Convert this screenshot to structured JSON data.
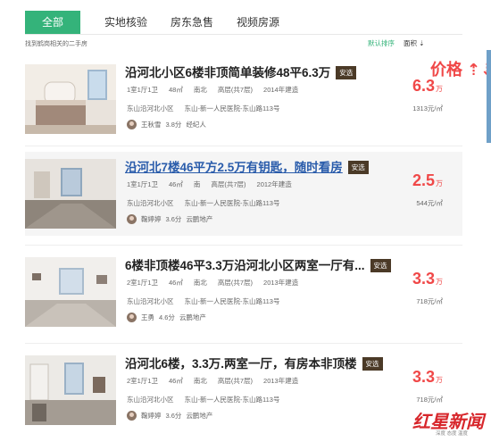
{
  "tabs": [
    {
      "label": "全部",
      "active": true
    },
    {
      "label": "实地核验",
      "active": false
    },
    {
      "label": "房东急售",
      "active": false
    },
    {
      "label": "视频房源",
      "active": false
    }
  ],
  "subbar": {
    "count_text": "找到鹤岗相关的二手房",
    "sort_default": "默认排序",
    "sort_area": "面积 ⇣",
    "sort_price": "价格 ⇡⇣"
  },
  "listings": [
    {
      "title": "沿河北小区6楼非顶简单装修48平6.3万",
      "badge": "安选",
      "layout": "1室1厅1卫",
      "area": "48㎡",
      "orientation": "南北",
      "floor": "高层(共7层)",
      "year": "2014年建造",
      "community": "东山沿河北小区",
      "address": "东山-新一人民医院-东山路113号",
      "agent_name": "王秋雪",
      "agent_score": "3.8分",
      "agent_company": "经纪人",
      "price": "6.3",
      "price_unit": "万",
      "unit_price": "1313元/㎡"
    },
    {
      "title": "沿河北7楼46平方2.5万有钥匙，随时看房",
      "badge": "安选",
      "layout": "1室1厅1卫",
      "area": "46㎡",
      "orientation": "南",
      "floor": "高层(共7层)",
      "year": "2012年建造",
      "community": "东山沿河北小区",
      "address": "东山-新一人民医院-东山路113号",
      "agent_name": "鞠婷婷",
      "agent_score": "3.6分",
      "agent_company": "云鹏地产",
      "price": "2.5",
      "price_unit": "万",
      "unit_price": "544元/㎡"
    },
    {
      "title": "6楼非顶楼46平3.3万沿河北小区两室一厅有...",
      "badge": "安选",
      "layout": "2室1厅1卫",
      "area": "46㎡",
      "orientation": "南北",
      "floor": "高层(共7层)",
      "year": "2013年建造",
      "community": "东山沿河北小区",
      "address": "东山-新一人民医院-东山路113号",
      "agent_name": "王勇",
      "agent_score": "4.6分",
      "agent_company": "云鹏地产",
      "price": "3.3",
      "price_unit": "万",
      "unit_price": "718元/㎡"
    },
    {
      "title": "沿河北6楼，3.3万.两室一厅，有房本非顶楼",
      "badge": "安选",
      "layout": "2室1厅1卫",
      "area": "46㎡",
      "orientation": "南北",
      "floor": "高层(共7层)",
      "year": "2013年建造",
      "community": "东山沿河北小区",
      "address": "东山-新一人民医院-东山路113号",
      "agent_name": "鞠婷婷",
      "agent_score": "3.6分",
      "agent_company": "云鹏地产",
      "price": "3.3",
      "price_unit": "万",
      "unit_price": "718元/㎡"
    }
  ],
  "watermark": {
    "main": "红星新闻",
    "sub": "深度 态度 温度"
  },
  "colors": {
    "accent": "#34b37a",
    "price": "#f04848",
    "badge": "#4b3a27",
    "link": "#2a5cab"
  }
}
